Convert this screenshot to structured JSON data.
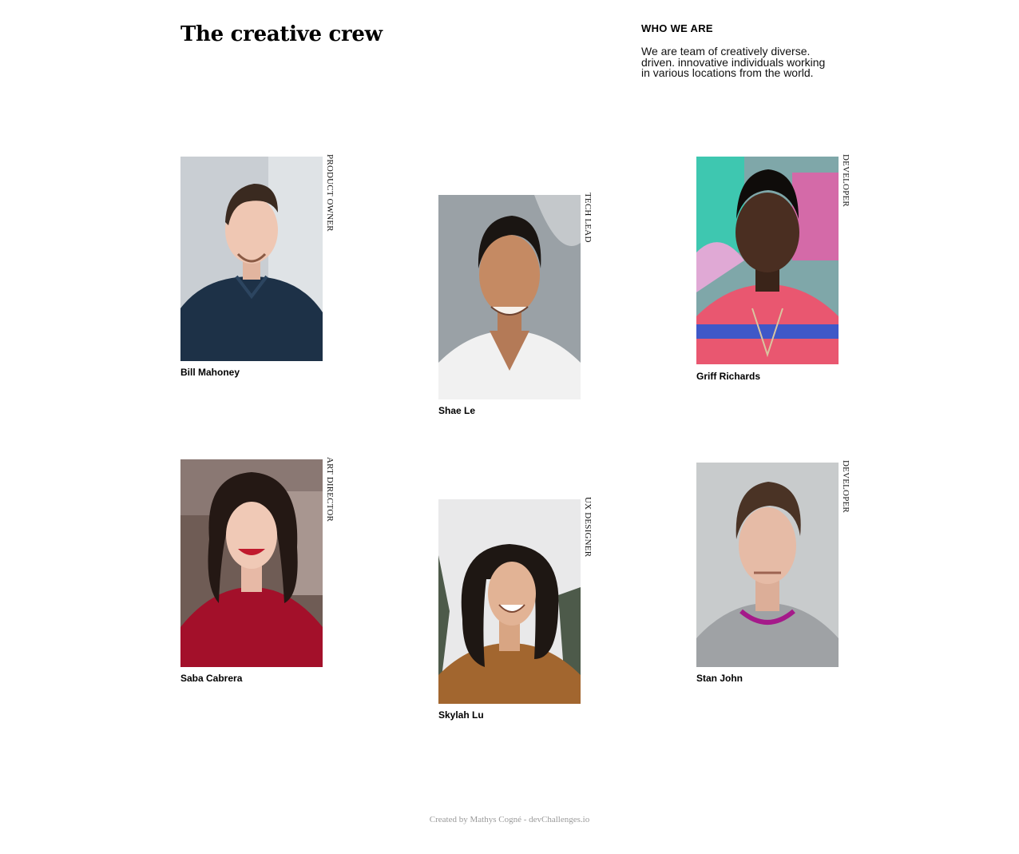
{
  "header": {
    "title": "The creative crew"
  },
  "about": {
    "heading": "WHO WE ARE",
    "text": "We are team of creatively diverse. driven. innovative individuals working in various locations from the world."
  },
  "members": [
    {
      "name": "Bill Mahoney",
      "role": "PRODUCT OWNER",
      "photo": "portrait-bill-mahoney"
    },
    {
      "name": "Shae Le",
      "role": "TECH LEAD",
      "photo": "portrait-shae-le"
    },
    {
      "name": "Griff Richards",
      "role": "DEVELOPER",
      "photo": "portrait-griff-richards"
    },
    {
      "name": "Saba Cabrera",
      "role": "ART DIRECTOR",
      "photo": "portrait-saba-cabrera"
    },
    {
      "name": "Skylah Lu",
      "role": "UX DESIGNER",
      "photo": "portrait-skylah-lu"
    },
    {
      "name": "Stan John",
      "role": "DEVELOPER",
      "photo": "portrait-stan-john"
    }
  ],
  "footer": {
    "credit": "Created by Mathys Cogné - devChallenges.io"
  }
}
